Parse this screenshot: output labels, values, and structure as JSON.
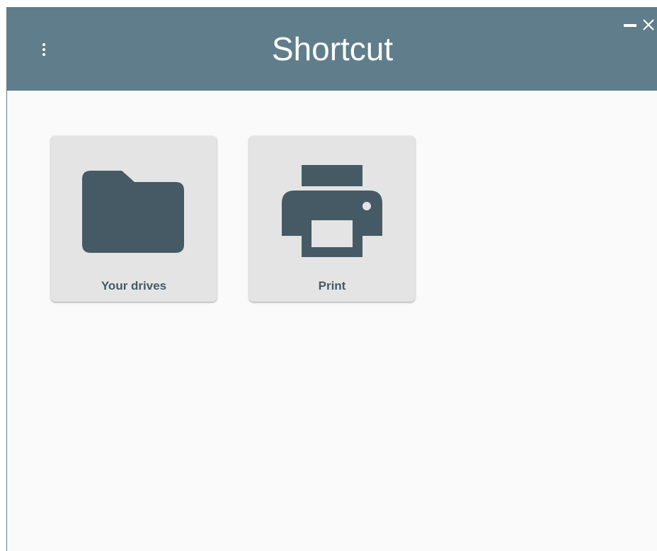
{
  "window": {
    "title": "Shortcut",
    "controls": {
      "minimize_icon": "minimize-icon",
      "close_icon": "close-icon"
    },
    "menu_icon": "more-vertical-icon"
  },
  "tiles": [
    {
      "label": "Your drives",
      "icon": "folder-icon"
    },
    {
      "label": "Print",
      "icon": "printer-icon"
    }
  ],
  "colors": {
    "header": "#607d8b",
    "icon": "#455a64",
    "tile": "#e4e4e4",
    "background": "#fafafa"
  }
}
